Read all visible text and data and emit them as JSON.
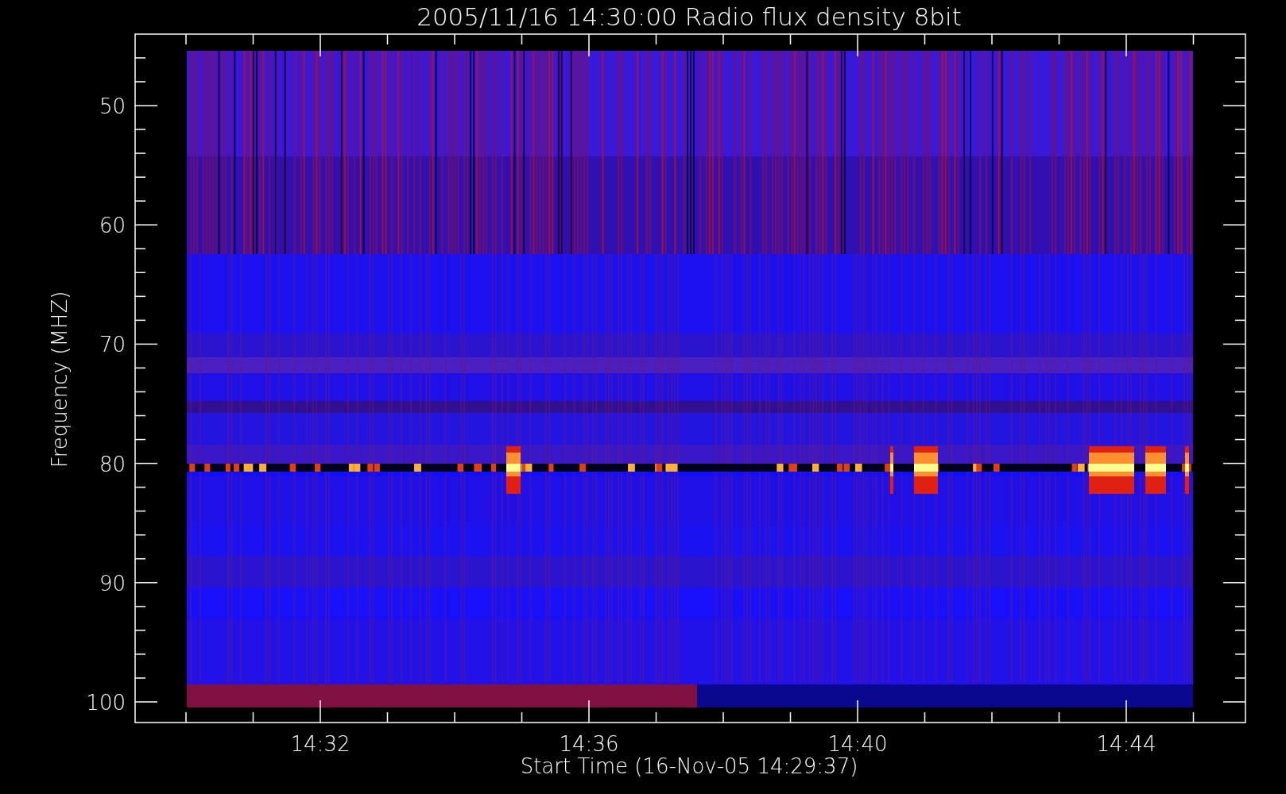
{
  "title": "2005/11/16 14:30:00 Radio flux density 8bit",
  "y_axis": {
    "label": "Frequency (MHZ)",
    "ticks": [
      "50",
      "60",
      "70",
      "80",
      "90",
      "100"
    ]
  },
  "x_axis": {
    "label": "Start Time (16-Nov-05 14:29:37)",
    "ticks": [
      "14:32",
      "14:36",
      "14:40",
      "14:44"
    ]
  }
}
